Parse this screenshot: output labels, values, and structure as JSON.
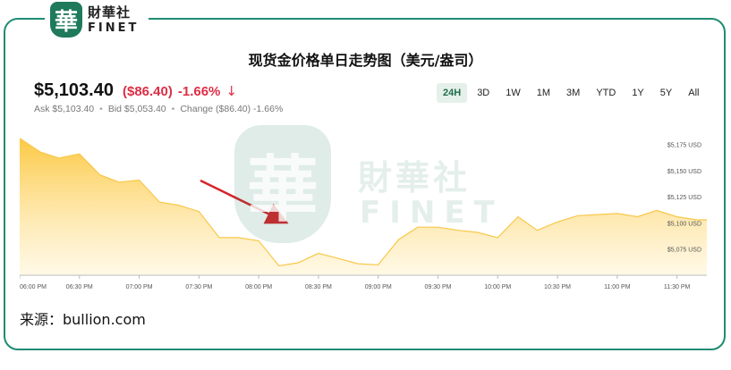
{
  "logo": {
    "seal_char": "華",
    "cn": "財華社",
    "en": "FINET"
  },
  "title": "现货金价格单日走势图（美元/盎司）",
  "quote": {
    "price": "$5,103.40",
    "change": "($86.40)",
    "change_pct": "-1.66%",
    "arrow": "↓",
    "ask": "Ask $5,103.40",
    "bid": "Bid $5,053.40",
    "change_text": "Change ($86.40) -1.66%",
    "separator": "•"
  },
  "ranges": [
    "24H",
    "3D",
    "1W",
    "1M",
    "3M",
    "YTD",
    "1Y",
    "5Y",
    "All"
  ],
  "active_range": "24H",
  "watermark": {
    "seal_char": "華",
    "cn": "財華社",
    "en": "FINET"
  },
  "source": "来源：bullion.com",
  "colors": {
    "brand": "#1f7a5c",
    "down": "#dc2f45",
    "area": "#fdd87a",
    "line": "#f8c84a"
  },
  "chart_data": {
    "type": "area",
    "x_ticks": [
      "06:00 PM",
      "06:30 PM",
      "07:00 PM",
      "07:30 PM",
      "08:00 PM",
      "08:30 PM",
      "09:00 PM",
      "09:30 PM",
      "10:00 PM",
      "10:30 PM",
      "11:00 PM",
      "11:30 PM"
    ],
    "y_ticks": [
      "$5,175 USD",
      "$5,150 USD",
      "$5,125 USD",
      "$5,100 USD",
      "$5,075 USD"
    ],
    "y_tick_values": [
      5175,
      5150,
      5125,
      5100,
      5075
    ],
    "ylim": [
      5050,
      5185
    ],
    "xlim_hours": [
      18.0,
      23.75
    ],
    "x_hours": [
      18.0,
      18.17,
      18.33,
      18.5,
      18.67,
      18.83,
      19.0,
      19.17,
      19.33,
      19.5,
      19.67,
      19.83,
      20.0,
      20.17,
      20.33,
      20.5,
      20.67,
      20.83,
      21.0,
      21.17,
      21.33,
      21.5,
      21.67,
      21.83,
      22.0,
      22.17,
      22.33,
      22.5,
      22.67,
      22.83,
      23.0,
      23.17,
      23.33,
      23.5,
      23.67,
      23.75
    ],
    "values": [
      5181,
      5168,
      5162,
      5166,
      5146,
      5139,
      5141,
      5120,
      5117,
      5111,
      5086,
      5086,
      5083,
      5059,
      5062,
      5071,
      5066,
      5061,
      5060,
      5084,
      5096,
      5096,
      5093,
      5091,
      5086,
      5106,
      5093,
      5101,
      5107,
      5108,
      5109,
      5106,
      5112,
      5106,
      5103,
      5103
    ]
  }
}
